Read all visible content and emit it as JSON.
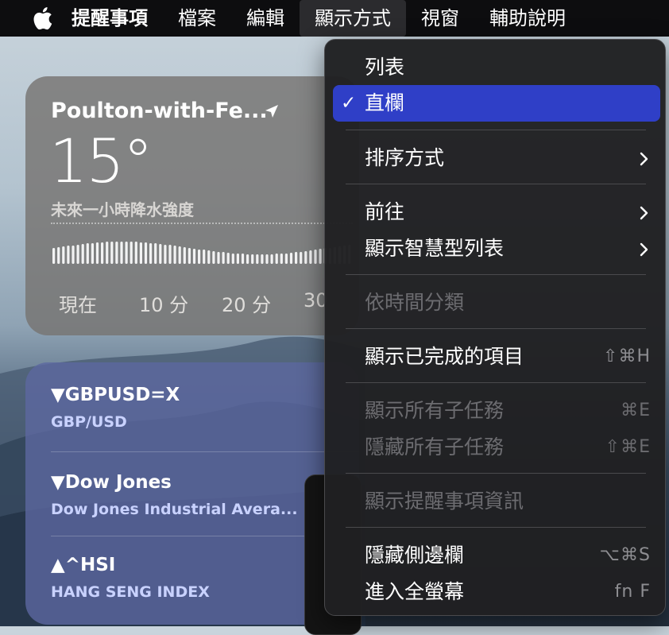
{
  "menubar": {
    "app_name": "提醒事項",
    "items": [
      "檔案",
      "編輯",
      "顯示方式",
      "視窗",
      "輔助說明"
    ]
  },
  "weather": {
    "location": "Poulton-with-Fe...",
    "temperature": "15°",
    "description": "未來一小時降水強度",
    "ticks": [
      "現在",
      "10 分",
      "20 分",
      "30"
    ]
  },
  "stocks": [
    {
      "symbol": "▼GBPUSD=X",
      "name": "GBP/USD"
    },
    {
      "symbol": "▼Dow Jones",
      "name": "Dow Jones Industrial Avera..."
    },
    {
      "symbol": "▲^HSI",
      "name": "HANG SENG INDEX"
    }
  ],
  "menu": {
    "list": "列表",
    "columns": "直欄",
    "checkmark": "✓",
    "sort_by": "排序方式",
    "go_to": "前往",
    "show_smart_list": "顯示智慧型列表",
    "group_by_time": "依時間分類",
    "show_completed": "顯示已完成的項目",
    "show_completed_shortcut": "⇧⌘H",
    "show_all_subtasks": "顯示所有子任務",
    "show_all_subtasks_shortcut": "⌘E",
    "hide_all_subtasks": "隱藏所有子任務",
    "hide_all_subtasks_shortcut": "⇧⌘E",
    "show_reminder_info": "顯示提醒事項資訊",
    "hide_sidebar": "隱藏側邊欄",
    "hide_sidebar_shortcut": "⌥⌘S",
    "enter_fullscreen": "進入全螢幕",
    "enter_fullscreen_shortcut": "fn F"
  },
  "colors": {
    "menu_selection": "#2f3fc7",
    "menubar": "#0d0d0f"
  }
}
